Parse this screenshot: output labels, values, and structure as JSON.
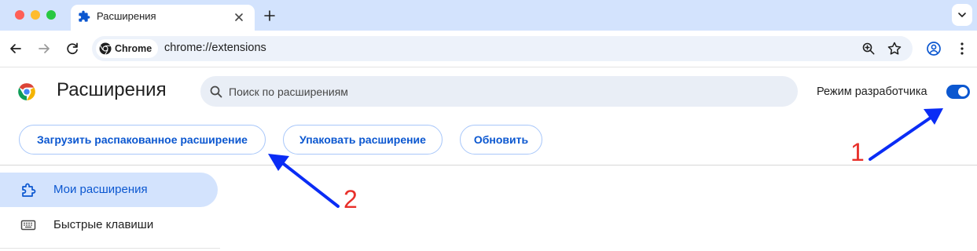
{
  "browser": {
    "tab": {
      "title": "Расширения",
      "icon": "puzzle-piece-icon"
    },
    "omnibox": {
      "chip_label": "Chrome",
      "url": "chrome://extensions"
    },
    "toolbar_icons": [
      "back-arrow-icon",
      "forward-arrow-icon",
      "reload-icon",
      "zoom-icon",
      "bookmark-star-icon",
      "profile-icon",
      "menu-dots-icon"
    ]
  },
  "page": {
    "title": "Расширения",
    "search": {
      "placeholder": "Поиск по расширениям",
      "value": ""
    },
    "developer_mode": {
      "label": "Режим разработчика",
      "enabled": true
    },
    "actions": {
      "load_unpacked": "Загрузить распакованное расширение",
      "pack": "Упаковать расширение",
      "update": "Обновить"
    },
    "sidebar": {
      "items": [
        {
          "label": "Мои расширения",
          "icon": "extension-icon",
          "active": true
        },
        {
          "label": "Быстрые клавиши",
          "icon": "keyboard-icon",
          "active": false
        }
      ]
    }
  },
  "annotations": {
    "labels": [
      "1",
      "2"
    ],
    "arrow_color": "#0a2cf5",
    "number_color": "#e8302a"
  },
  "colors": {
    "accent": "#0b57d0",
    "tabstrip": "#d3e3fd",
    "active_nav": "#d3e3fd"
  }
}
